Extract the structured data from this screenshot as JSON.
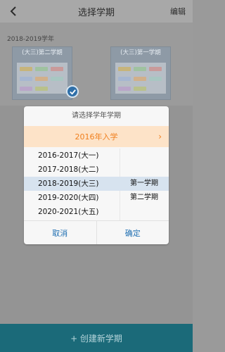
{
  "header": {
    "title": "选择学期",
    "edit_label": "编辑"
  },
  "section": {
    "year_label": "2018-2019学年"
  },
  "cards": [
    {
      "caption": "(大三)第二学期"
    },
    {
      "caption": "(大三)第一学期"
    }
  ],
  "dialog": {
    "title": "请选择学年学期",
    "entry_year": "2016年入学",
    "years": [
      "2016-2017(大一)",
      "2017-2018(大二)",
      "2018-2019(大三)",
      "2019-2020(大四)",
      "2020-2021(大五)"
    ],
    "selected_year_index": 2,
    "terms": [
      "",
      "",
      "第一学期",
      "第二学期",
      ""
    ],
    "selected_term_index": 2,
    "cancel_label": "取消",
    "confirm_label": "确定"
  },
  "bottom": {
    "create_label": "+ 创建新学期"
  },
  "colors": {
    "accent": "#1f6fb2",
    "entry": "#f07f1d",
    "bottom_bar": "#1b6a79"
  }
}
